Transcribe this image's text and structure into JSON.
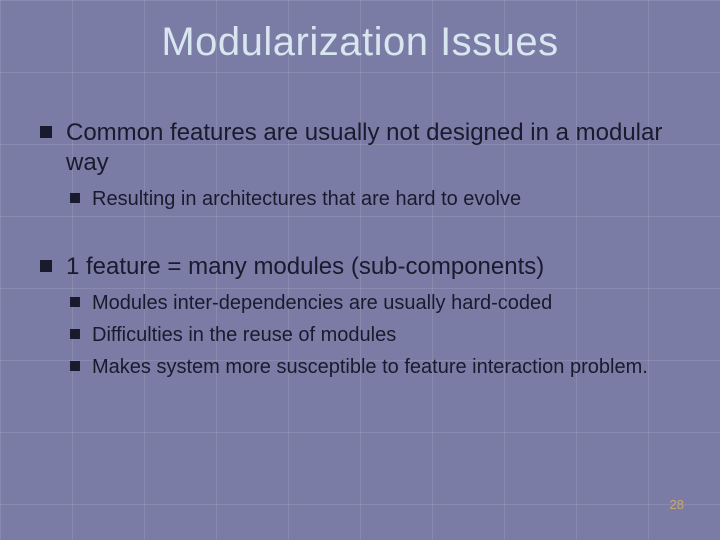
{
  "title": "Modularization Issues",
  "bullets": {
    "b1": "Common features are usually not designed in a modular way",
    "b1_1": "Resulting in architectures that are hard to evolve",
    "b2": "1 feature = many modules (sub-components)",
    "b2_1": "Modules inter-dependencies are usually hard-coded",
    "b2_2": "Difficulties in the reuse of modules",
    "b2_3": "Makes system more susceptible to feature interaction problem."
  },
  "page_number": "28"
}
